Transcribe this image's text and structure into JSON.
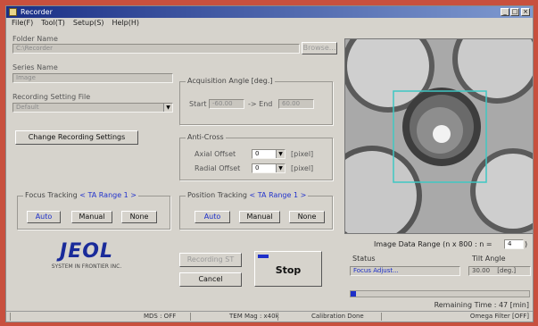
{
  "window": {
    "title": "Recorder"
  },
  "menu": [
    "File(F)",
    "Tool(T)",
    "Setup(S)",
    "Help(H)"
  ],
  "folder": {
    "label": "Folder Name",
    "value": "C:\\Recorder",
    "browse_label": "Browse..."
  },
  "series": {
    "label": "Series Name",
    "value": "Image"
  },
  "setting_file": {
    "label": "Recording Setting File",
    "value": "Default"
  },
  "change_settings_label": "Change Recording Settings",
  "acquisition": {
    "title": "Acquisition Angle [deg.]",
    "start_label": "Start",
    "start_value": "-60.00",
    "arrow_label": "-> End",
    "end_value": "60.00"
  },
  "anticross": {
    "title": "Anti-Cross",
    "axial_label": "Axial Offset",
    "axial_value": "0",
    "axial_unit": "[pixel]",
    "radial_label": "Radial Offset",
    "radial_value": "0",
    "radial_unit": "[pixel]"
  },
  "focus": {
    "title": "Focus Tracking",
    "range": "< TA Range 1 >",
    "auto": "Auto",
    "manual": "Manual",
    "none": "None"
  },
  "position": {
    "title": "Position Tracking",
    "range": "< TA Range 1 >",
    "auto": "Auto",
    "manual": "Manual",
    "none": "None"
  },
  "logo": {
    "brand": "JEOL",
    "tagline": "SYSTEM IN FRONTIER INC."
  },
  "buttons": {
    "start": "Recording ST",
    "cancel": "Cancel",
    "stop": "Stop"
  },
  "image_range": {
    "label": "Image Data Range (n x 800 : n =",
    "value": "4",
    "suffix": ")"
  },
  "status": {
    "label": "Status",
    "value": "Focus Adjust..."
  },
  "tilt": {
    "label": "Tilt Angle",
    "value": "30.00",
    "unit": "[deg.]"
  },
  "progress": {
    "fraction": 0.03
  },
  "remaining": "Remaining Time : 47 [min]",
  "statusbar": {
    "mds": "MDS : OFF",
    "tem_mag": "TEM Mag : x40k",
    "calibration": "Calibration Done",
    "omega": "Omega Filter [OFF]"
  },
  "colors": {
    "accent_blue": "#1d2fc9",
    "roi_cyan": "#3fc7c3",
    "backdrop": "#c8503e"
  }
}
